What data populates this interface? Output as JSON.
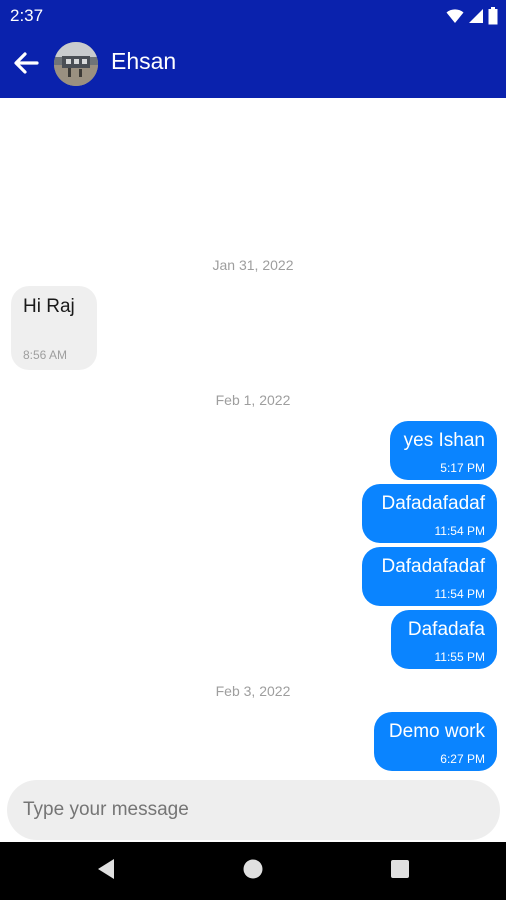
{
  "status_bar": {
    "time": "2:37"
  },
  "header": {
    "contact_name": "Ehsan"
  },
  "chat": {
    "date_1": "Jan 31, 2022",
    "date_2": "Feb 1, 2022",
    "date_3": "Feb 3, 2022",
    "messages": [
      {
        "text": "Hi Raj",
        "time": "8:56 AM",
        "direction": "incoming"
      },
      {
        "text": "yes Ishan",
        "time": "5:17 PM",
        "direction": "outgoing"
      },
      {
        "text": "Dafadafadaf",
        "time": "11:54 PM",
        "direction": "outgoing"
      },
      {
        "text": "Dafadafadaf",
        "time": "11:54 PM",
        "direction": "outgoing"
      },
      {
        "text": "Dafadafa",
        "time": "11:55 PM",
        "direction": "outgoing"
      },
      {
        "text": "Demo work",
        "time": "6:27 PM",
        "direction": "outgoing"
      }
    ]
  },
  "composer": {
    "placeholder": "Type your message"
  },
  "colors": {
    "header_bg": "#0a22ad",
    "outgoing_bubble": "#0a84ff",
    "incoming_bubble": "#efefef"
  },
  "icons": [
    "back-arrow-icon",
    "wifi-icon",
    "signal-icon",
    "battery-icon",
    "nav-back-icon",
    "nav-home-icon",
    "nav-recents-icon"
  ]
}
